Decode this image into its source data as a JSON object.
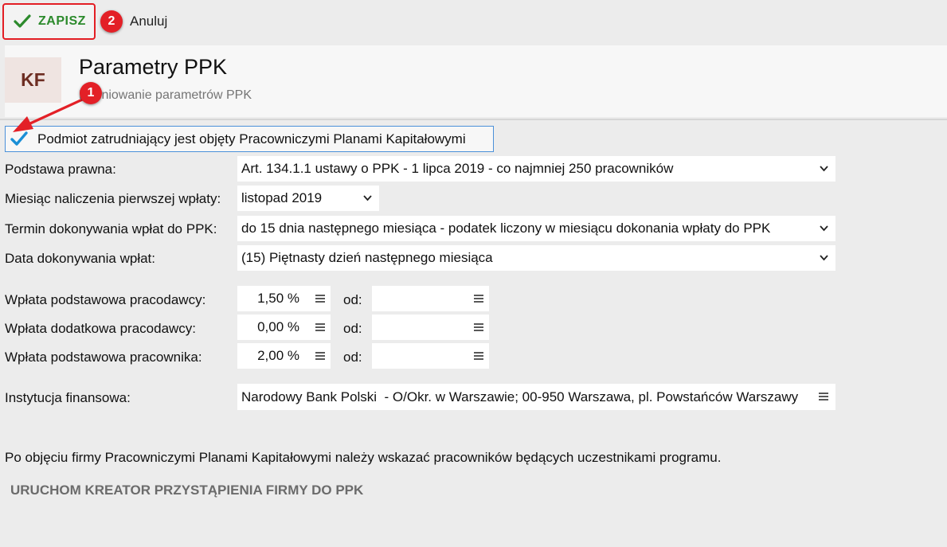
{
  "toolbar": {
    "save_label": "ZAPISZ",
    "cancel_label": "Anuluj"
  },
  "annotations": {
    "badge_1": "1",
    "badge_2": "2"
  },
  "header": {
    "logo_text": "KF",
    "title": "Parametry PPK",
    "subtitle": "Definiowanie parametrów PPK"
  },
  "ppk_checkbox": {
    "label": "Podmiot zatrudniający jest objęty Pracowniczymi Planami Kapitałowymi",
    "checked": true
  },
  "fields": {
    "podstawa": {
      "label": "Podstawa prawna:",
      "value": "Art. 134.1.1 ustawy o PPK - 1 lipca 2019 - co najmniej 250 pracowników"
    },
    "miesiac": {
      "label": "Miesiąc naliczenia pierwszej wpłaty:",
      "value": "listopad 2019"
    },
    "termin": {
      "label": "Termin dokonywania wpłat do PPK:",
      "value": "do 15 dnia następnego miesiąca - podatek liczony w miesiącu dokonania wpłaty do PPK"
    },
    "data": {
      "label": "Data dokonywania wpłat:",
      "value": "(15) Piętnasty dzień następnego miesiąca"
    }
  },
  "contributions": [
    {
      "label": "Wpłata podstawowa pracodawcy:",
      "value": "1,50 %",
      "od_label": "od:",
      "od_value": ""
    },
    {
      "label": "Wpłata dodatkowa pracodawcy:",
      "value": "0,00 %",
      "od_label": "od:",
      "od_value": ""
    },
    {
      "label": "Wpłata podstawowa pracownika:",
      "value": "2,00 %",
      "od_label": "od:",
      "od_value": ""
    }
  ],
  "institution": {
    "label": "Instytucja finansowa:",
    "value": "Narodowy Bank Polski  - O/Okr. w Warszawie; 00-950 Warszawa, pl. Powstańców Warszawy"
  },
  "info_text": "Po objęciu firmy Pracowniczymi Planami Kapitałowymi należy wskazać pracowników będących uczestnikami programu.",
  "wizard_link": "URUCHOM KREATOR PRZYSTĄPIENIA FIRMY DO PPK",
  "colors": {
    "accent_red": "#e31e24",
    "save_green": "#2c8a2c",
    "checkbox_blue": "#1a8fd6",
    "focus_blue": "#4a90d9"
  },
  "icons": [
    "check-icon",
    "chevron-down-icon",
    "menu-lines-icon",
    "arrow-annotation"
  ]
}
